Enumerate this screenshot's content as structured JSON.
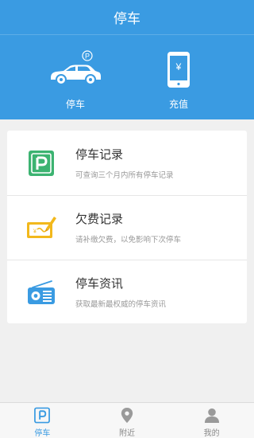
{
  "header": {
    "title": "停车",
    "quick_actions": [
      {
        "label": "停车",
        "icon": "car-icon",
        "badge": "P"
      },
      {
        "label": "充值",
        "icon": "phone-yen-icon",
        "badge": "¥"
      }
    ]
  },
  "menu": [
    {
      "title": "停车记录",
      "subtitle": "可查询三个月内所有停车记录",
      "icon": "parking-sign-icon"
    },
    {
      "title": "欠费记录",
      "subtitle": "请补缴欠费，以免影响下次停车",
      "icon": "ticket-pen-icon"
    },
    {
      "title": "停车资讯",
      "subtitle": "获取最新最权威的停车资讯",
      "icon": "radio-icon"
    }
  ],
  "tabbar": [
    {
      "label": "停车",
      "icon": "parking-tab-icon",
      "active": true
    },
    {
      "label": "附近",
      "icon": "location-pin-icon",
      "active": false
    },
    {
      "label": "我的",
      "icon": "user-icon",
      "active": false
    }
  ],
  "colors": {
    "primary": "#3a9be2",
    "background": "#f0f0f0",
    "parking_green": "#3cb371",
    "ticket_yellow": "#f2b81c",
    "radio_blue": "#3a9be2"
  }
}
